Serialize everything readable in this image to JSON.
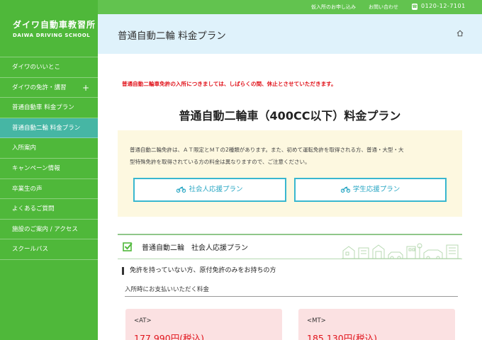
{
  "colors": {
    "sidebar": "#4fb83a",
    "active": "#46b6a4",
    "topbar": "#62c34f",
    "header": "#dff2fb",
    "notice": "#e1141c",
    "button_border": "#39b7cf",
    "info_bg": "#fdf8e0",
    "card_bg": "#fbe1e2"
  },
  "logo": {
    "jp": "ダイワ自動車教習所",
    "en": "DAIWA DRIVING SCHOOL"
  },
  "topbar": {
    "apply": "仮入所のお申し込み",
    "contact": "お問い合わせ",
    "phone": "0120-12-7101",
    "phone_icon": "phone-icon"
  },
  "sidebar": {
    "items": [
      {
        "label": "ダイワのいいとこ"
      },
      {
        "label": "ダイワの免許・講習",
        "plus": "+"
      },
      {
        "label": "普通自動車 料金プラン"
      },
      {
        "label": "普通自動二輪 料金プラン",
        "active": true
      },
      {
        "label": "入所案内"
      },
      {
        "label": "キャンペーン情報"
      },
      {
        "label": "卒業生の声"
      },
      {
        "label": "よくあるご質問"
      },
      {
        "label": "施設のご案内 / アクセス"
      },
      {
        "label": "スクールバス"
      }
    ]
  },
  "header": {
    "title": "普通自動二輪 料金プラン",
    "home_icon": "home-icon"
  },
  "main": {
    "notice": "普通自動二輪車免許の入所につきましては、しばらくの間、休止とさせていただきます。",
    "heading": "普通自動二輪車（400CC以下）料金プラン",
    "info_line1": "普通自動二輪免許は、ＡＴ限定とＭＴの2種類があります。また、初めて運転免許を取得される方、普通・大型・大",
    "info_line2": "型特殊免許を取得されている方の料金は異なりますので、ご注意ください。",
    "btn_social": "社会人応援プラン",
    "btn_student": "学生応援プラン",
    "section_title": "普通自動二輪　社会人応援プラン",
    "subhead": "免許を持っていない方、原付免許のみをお持ちの方",
    "line_label": "入所時にお支払いいただく料金",
    "cards": [
      {
        "label": "<AT>",
        "price": "177,990円(税込)"
      },
      {
        "label": "<MT>",
        "price": "185,130円(税込)"
      }
    ]
  }
}
